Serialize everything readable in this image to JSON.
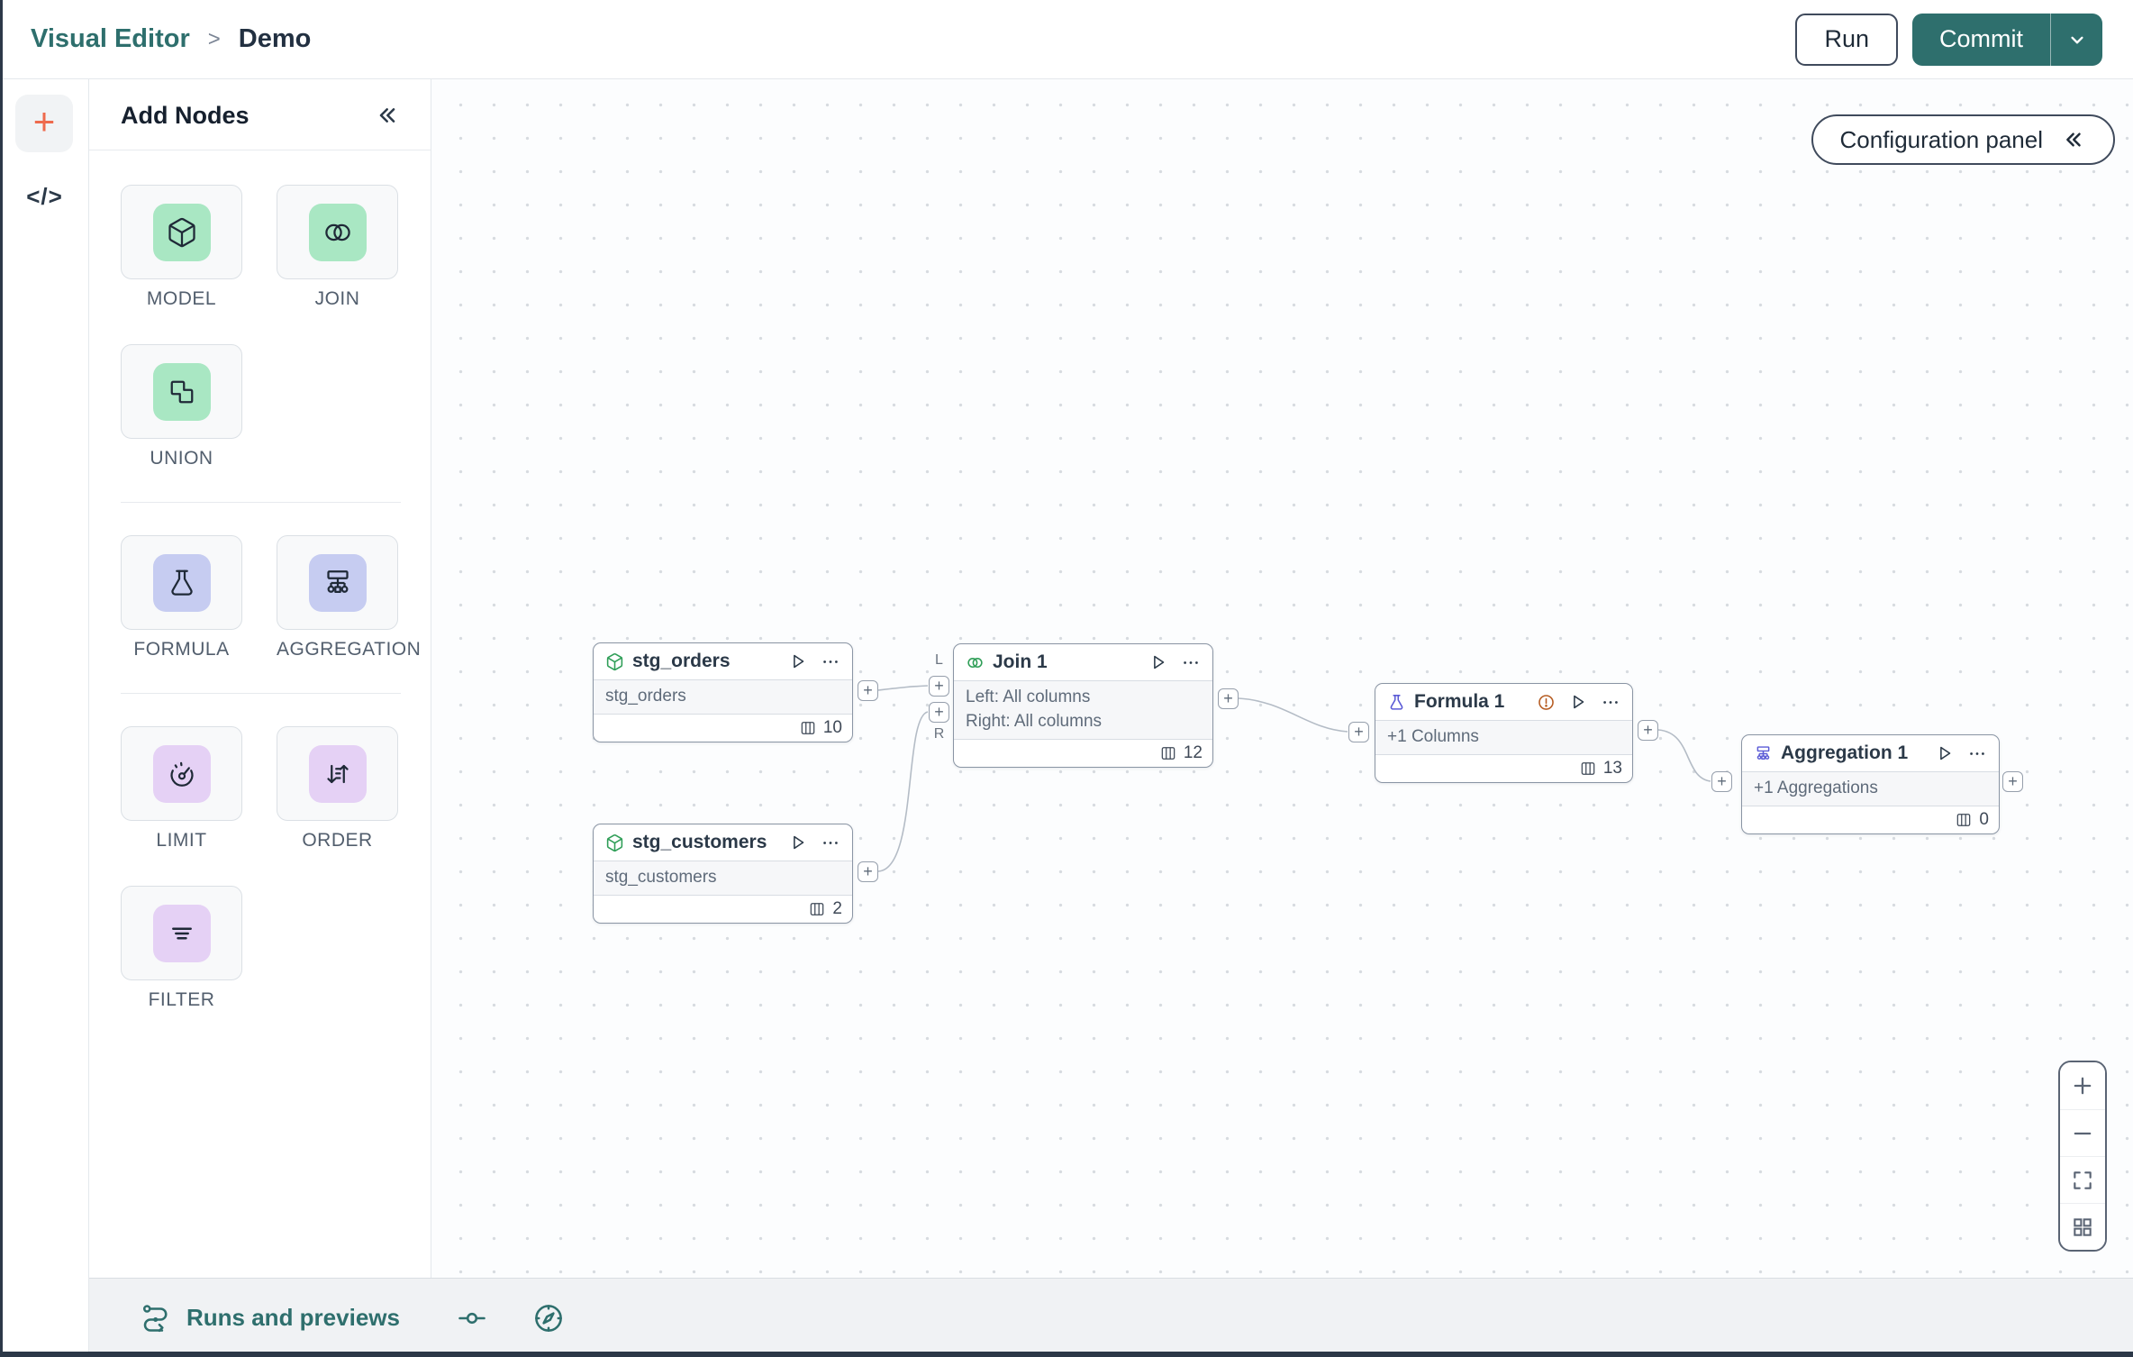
{
  "topbar": {
    "breadcrumb_root": "Visual Editor",
    "breadcrumb_sep": ">",
    "breadcrumb_current": "Demo",
    "run_label": "Run",
    "commit_label": "Commit"
  },
  "panel": {
    "title": "Add Nodes",
    "tiles": [
      {
        "label": "MODEL"
      },
      {
        "label": "JOIN"
      },
      {
        "label": "UNION"
      },
      {
        "label": "FORMULA"
      },
      {
        "label": "AGGREGATION"
      },
      {
        "label": "LIMIT"
      },
      {
        "label": "ORDER"
      },
      {
        "label": "FILTER"
      }
    ]
  },
  "canvas": {
    "config_panel_label": "Configuration panel",
    "port_plus": "+",
    "port_labels": {
      "left": "L",
      "right": "R"
    },
    "nodes": [
      {
        "title": "stg_orders",
        "body": [
          "stg_orders"
        ],
        "columns_count": "10"
      },
      {
        "title": "stg_customers",
        "body": [
          "stg_customers"
        ],
        "columns_count": "2"
      },
      {
        "title": "Join 1",
        "body": [
          "Left: All columns",
          "Right: All columns"
        ],
        "columns_count": "12"
      },
      {
        "title": "Formula 1",
        "body": [
          "+1 Columns"
        ],
        "columns_count": "13"
      },
      {
        "title": "Aggregation 1",
        "body": [
          "+1 Aggregations"
        ],
        "columns_count": "0"
      }
    ]
  },
  "bottom_bar": {
    "runs_label": "Runs and previews"
  },
  "colors": {
    "teal": "#2e6f6d",
    "green_tile": "#a9e7c3",
    "lavender_tile": "#c6ccf1",
    "purple_tile": "#e5d1f5",
    "rail_plus_orange": "#ee6a4d",
    "node_green_icon": "#2f9e57",
    "node_indigo_icon": "#5b5bd6",
    "warning_orange": "#b65c22"
  }
}
